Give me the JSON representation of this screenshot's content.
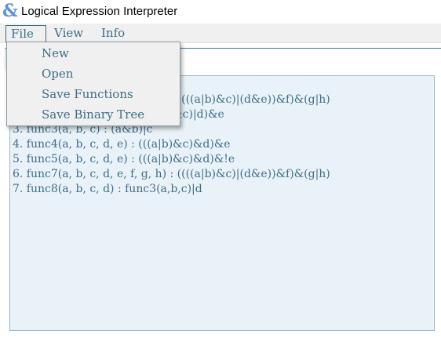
{
  "window": {
    "icon": "ampersand-icon",
    "icon_glyph": "&",
    "title": "Logical Expression Interpreter"
  },
  "menubar": {
    "items": [
      {
        "label": "File"
      },
      {
        "label": "View"
      },
      {
        "label": "Info"
      }
    ]
  },
  "file_menu": {
    "items": [
      {
        "label": "New"
      },
      {
        "label": "Open"
      },
      {
        "label": "Save Functions"
      },
      {
        "label": "Save Binary Tree"
      }
    ]
  },
  "editor": {
    "lines": [
      "1. func1(a, b, c, d, e, f, g, h) : ((((a|b)&c)|(d&e))&f)&(g|h)",
      "2. func2(a, b, c, d, e) : (((a|b)&c)|d)&e",
      "3. func3(a, b, c) : (a&b)|c",
      "4. func4(a, b, c, d, e) : (((a|b)&c)&d)&e",
      "5. func5(a, b, c, d, e) : (((a|b)&c)&d)&!e",
      "6. func7(a, b, c, d, e, f, g, h) : ((((a|b)&c)|(d&e))&f)&(g|h)",
      "7. func8(a, b, c, d) : func3(a,b,c)|d"
    ]
  },
  "colors": {
    "accent": "#3d6e86",
    "editor_bg": "#e9f2f8",
    "border": "#2f7c97"
  }
}
